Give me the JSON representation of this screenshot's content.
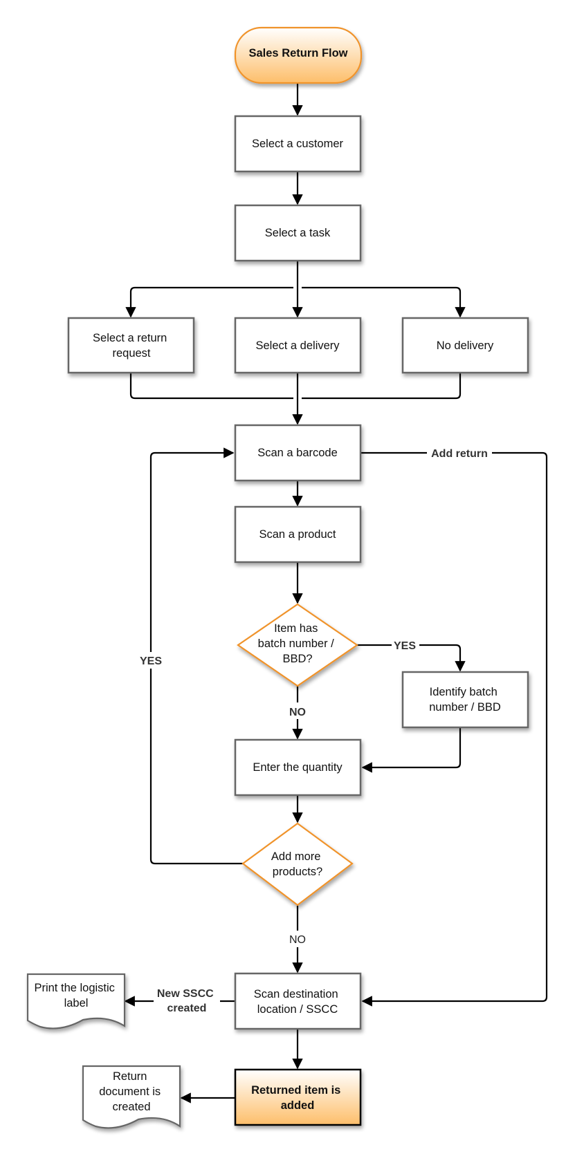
{
  "diagram": {
    "title": "Sales Return Flow",
    "accent_color": "#F0932B",
    "nodes": {
      "start": "Sales Return Flow",
      "select_customer": "Select a customer",
      "select_task": "Select a task",
      "select_return_request": [
        "Select a return",
        "request"
      ],
      "select_delivery": "Select a delivery",
      "no_delivery": "No delivery",
      "scan_barcode": "Scan a barcode",
      "scan_product": "Scan a product",
      "batch_decision": [
        "Item has",
        "batch number /",
        "BBD?"
      ],
      "identify_batch": [
        "Identify batch",
        "number / BBD"
      ],
      "enter_quantity": "Enter the quantity",
      "more_products_decision": [
        "Add more",
        "products?"
      ],
      "scan_destination": [
        "Scan destination",
        "location / SSCC"
      ],
      "print_label": [
        "Print the logistic",
        "label"
      ],
      "returned_item_added": [
        "Returned item is",
        "added"
      ],
      "return_document": [
        "Return",
        "document is",
        "created"
      ]
    },
    "edge_labels": {
      "add_return": "Add return",
      "batch_yes": "YES",
      "batch_no": "NO",
      "more_yes": "YES",
      "more_no": "NO",
      "new_sscc": [
        "New SSCC",
        "created"
      ]
    }
  }
}
